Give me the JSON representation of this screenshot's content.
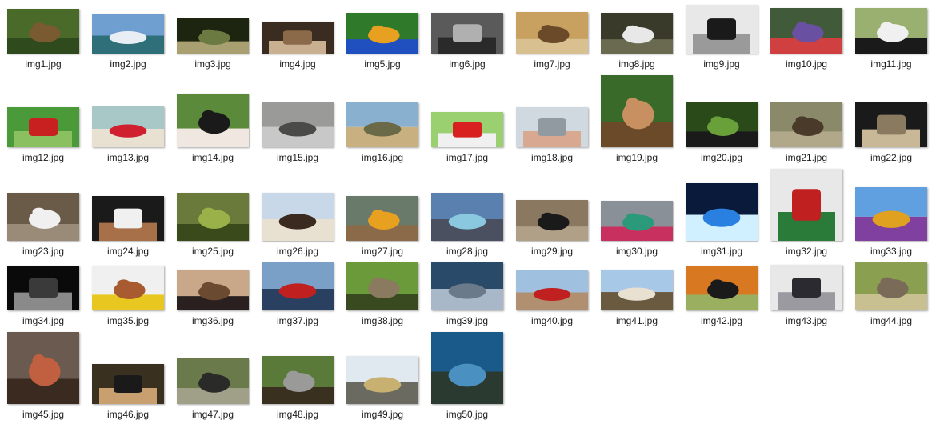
{
  "files": [
    {
      "name": "img1.jpg",
      "thumbnail": "deer-in-forest",
      "colors": [
        "#4a6a2a",
        "#7a5a30",
        "#2f4a1c"
      ]
    },
    {
      "name": "img2.jpg",
      "thumbnail": "snowy-mountain-lake",
      "colors": [
        "#6f9fd0",
        "#e8eef4",
        "#2f6f7a"
      ]
    },
    {
      "name": "img3.jpg",
      "thumbnail": "tortoise-in-grass",
      "colors": [
        "#1d2410",
        "#6b7a40",
        "#a8a070"
      ]
    },
    {
      "name": "img4.jpg",
      "thumbnail": "laptop-on-desk",
      "colors": [
        "#3a2c20",
        "#8a6a48",
        "#c8b090"
      ]
    },
    {
      "name": "img5.jpg",
      "thumbnail": "macaw-parrot",
      "colors": [
        "#2f7a2a",
        "#e8a020",
        "#2050c0"
      ]
    },
    {
      "name": "img6.jpg",
      "thumbnail": "steam-locomotive",
      "colors": [
        "#5a5a5a",
        "#b0b0b0",
        "#2a2a2a"
      ]
    },
    {
      "name": "img7.jpg",
      "thumbnail": "leopard-resting",
      "colors": [
        "#c8a060",
        "#6a4a28",
        "#d8c090"
      ]
    },
    {
      "name": "img8.jpg",
      "thumbnail": "white-wolf",
      "colors": [
        "#3a3a2a",
        "#e8e8e8",
        "#6a6a50"
      ]
    },
    {
      "name": "img9.jpg",
      "thumbnail": "rotary-telephone",
      "colors": [
        "#e8e8e8",
        "#1a1a1a",
        "#9a9a9a"
      ]
    },
    {
      "name": "img10.jpg",
      "thumbnail": "purple-swamphen",
      "colors": [
        "#405a3a",
        "#6a50a0",
        "#d04040"
      ]
    },
    {
      "name": "img11.jpg",
      "thumbnail": "panda-cubs",
      "colors": [
        "#9ab070",
        "#f0f0f0",
        "#1a1a1a"
      ]
    },
    {
      "name": "img12.jpg",
      "thumbnail": "ketchup-bottle-grass",
      "colors": [
        "#4a9a3a",
        "#c82020",
        "#8ac060"
      ]
    },
    {
      "name": "img13.jpg",
      "thumbnail": "red-heart-balloon",
      "colors": [
        "#a8c8c8",
        "#d02030",
        "#e8e0d0"
      ]
    },
    {
      "name": "img14.jpg",
      "thumbnail": "bernese-puppy",
      "colors": [
        "#5a8a3a",
        "#1a1a1a",
        "#f0e8e0"
      ]
    },
    {
      "name": "img15.jpg",
      "thumbnail": "husky-on-road",
      "colors": [
        "#9a9a98",
        "#4a4a48",
        "#c8c8c8"
      ]
    },
    {
      "name": "img16.jpg",
      "thumbnail": "tank-in-field",
      "colors": [
        "#8ab0d0",
        "#6a6a48",
        "#c8b080"
      ]
    },
    {
      "name": "img17.jpg",
      "thumbnail": "strawberries-bowl",
      "colors": [
        "#9ad070",
        "#d82020",
        "#f0f0f0"
      ]
    },
    {
      "name": "img18.jpg",
      "thumbnail": "stopwatch-in-hand",
      "colors": [
        "#d0d8e0",
        "#909aa0",
        "#d8a890"
      ]
    },
    {
      "name": "img19.jpg",
      "thumbnail": "wooden-birdhouse",
      "colors": [
        "#3a6a2a",
        "#c89060",
        "#6a4a28"
      ]
    },
    {
      "name": "img20.jpg",
      "thumbnail": "butterfly-on-plant",
      "colors": [
        "#2a4a1a",
        "#6aa03a",
        "#1a1a1a"
      ]
    },
    {
      "name": "img21.jpg",
      "thumbnail": "mouse-on-branch",
      "colors": [
        "#8a8a6a",
        "#4a3a2a",
        "#b0a888"
      ]
    },
    {
      "name": "img22.jpg",
      "thumbnail": "wristwatch",
      "colors": [
        "#1a1a1a",
        "#8a7a60",
        "#c8b898"
      ]
    },
    {
      "name": "img23.jpg",
      "thumbnail": "white-spitz-dog",
      "colors": [
        "#6a5a48",
        "#f0f0f0",
        "#9a8a78"
      ]
    },
    {
      "name": "img24.jpg",
      "thumbnail": "latte-art-cup",
      "colors": [
        "#1a1a1a",
        "#f0f0f0",
        "#a87048"
      ]
    },
    {
      "name": "img25.jpg",
      "thumbnail": "chameleon-branches",
      "colors": [
        "#6a7a3a",
        "#9ab048",
        "#3a4a1a"
      ]
    },
    {
      "name": "img26.jpg",
      "thumbnail": "horse-carriage",
      "colors": [
        "#c8d8e8",
        "#3a2a20",
        "#e8e0d0"
      ]
    },
    {
      "name": "img27.jpg",
      "thumbnail": "chipmunk-corn",
      "colors": [
        "#6a7a6a",
        "#e8a020",
        "#8a6a48"
      ]
    },
    {
      "name": "img28.jpg",
      "thumbnail": "sports-car-road",
      "colors": [
        "#5a80b0",
        "#8ac8e0",
        "#4a5060"
      ]
    },
    {
      "name": "img29.jpg",
      "thumbnail": "spider-on-dirt",
      "colors": [
        "#8a7860",
        "#1a1a1a",
        "#b0a088"
      ]
    },
    {
      "name": "img30.jpg",
      "thumbnail": "hummingbird",
      "colors": [
        "#8a9098",
        "#2a9a7a",
        "#c83060"
      ]
    },
    {
      "name": "img31.jpg",
      "thumbnail": "earth-from-space",
      "colors": [
        "#0a1a3a",
        "#2a80e0",
        "#d0f0ff"
      ]
    },
    {
      "name": "img32.jpg",
      "thumbnail": "christmas-stockings",
      "colors": [
        "#e8e8e8",
        "#c02020",
        "#2a7a3a"
      ]
    },
    {
      "name": "img33.jpg",
      "thumbnail": "hot-air-balloon",
      "colors": [
        "#60a0e0",
        "#e0a020",
        "#8040a0"
      ]
    },
    {
      "name": "img34.jpg",
      "thumbnail": "dslr-camera",
      "colors": [
        "#0a0a0a",
        "#3a3a3a",
        "#8a8a8a"
      ]
    },
    {
      "name": "img35.jpg",
      "thumbnail": "poodle-puppy",
      "colors": [
        "#f0f0f0",
        "#a85a30",
        "#e8c820"
      ]
    },
    {
      "name": "img36.jpg",
      "thumbnail": "platypus",
      "colors": [
        "#c8a888",
        "#6a4a30",
        "#2a2020"
      ]
    },
    {
      "name": "img37.jpg",
      "thumbnail": "cargo-ship",
      "colors": [
        "#7aa0c8",
        "#c02020",
        "#2a4060"
      ]
    },
    {
      "name": "img38.jpg",
      "thumbnail": "cat-in-grass",
      "colors": [
        "#6a9a3a",
        "#8a7a60",
        "#3a4a20"
      ]
    },
    {
      "name": "img39.jpg",
      "thumbnail": "aircraft-carrier",
      "colors": [
        "#2a4a6a",
        "#6a7a8a",
        "#a8b8c8"
      ]
    },
    {
      "name": "img40.jpg",
      "thumbnail": "red-car-mountains",
      "colors": [
        "#a0c0e0",
        "#c02020",
        "#b09070"
      ]
    },
    {
      "name": "img41.jpg",
      "thumbnail": "taj-mahal-camel",
      "colors": [
        "#a8c8e8",
        "#e8e0d0",
        "#6a5a40"
      ]
    },
    {
      "name": "img42.jpg",
      "thumbnail": "roaring-tiger",
      "colors": [
        "#d87820",
        "#1a1a1a",
        "#9ab060"
      ]
    },
    {
      "name": "img43.jpg",
      "thumbnail": "smartphone-earbuds",
      "colors": [
        "#e8e8e8",
        "#2a2a30",
        "#9a9aa0"
      ]
    },
    {
      "name": "img44.jpg",
      "thumbnail": "elephant",
      "colors": [
        "#8aa050",
        "#7a6a58",
        "#c8c090"
      ]
    },
    {
      "name": "img45.jpg",
      "thumbnail": "wooden-rabbit",
      "colors": [
        "#6a5a50",
        "#c06040",
        "#3a2a20"
      ]
    },
    {
      "name": "img46.jpg",
      "thumbnail": "polaroid-camera",
      "colors": [
        "#3a3020",
        "#1a1a1a",
        "#c8a070"
      ]
    },
    {
      "name": "img47.jpg",
      "thumbnail": "gorilla",
      "colors": [
        "#6a7a4a",
        "#2a2a28",
        "#a0a088"
      ]
    },
    {
      "name": "img48.jpg",
      "thumbnail": "koala-in-tree",
      "colors": [
        "#5a7a3a",
        "#9a9a98",
        "#3a3020"
      ]
    },
    {
      "name": "img49.jpg",
      "thumbnail": "crane-flying",
      "colors": [
        "#e0e8f0",
        "#c8b070",
        "#6a6a60"
      ]
    },
    {
      "name": "img50.jpg",
      "thumbnail": "sea-turtle",
      "colors": [
        "#1a5a8a",
        "#4a90c0",
        "#2a3a30"
      ]
    }
  ]
}
